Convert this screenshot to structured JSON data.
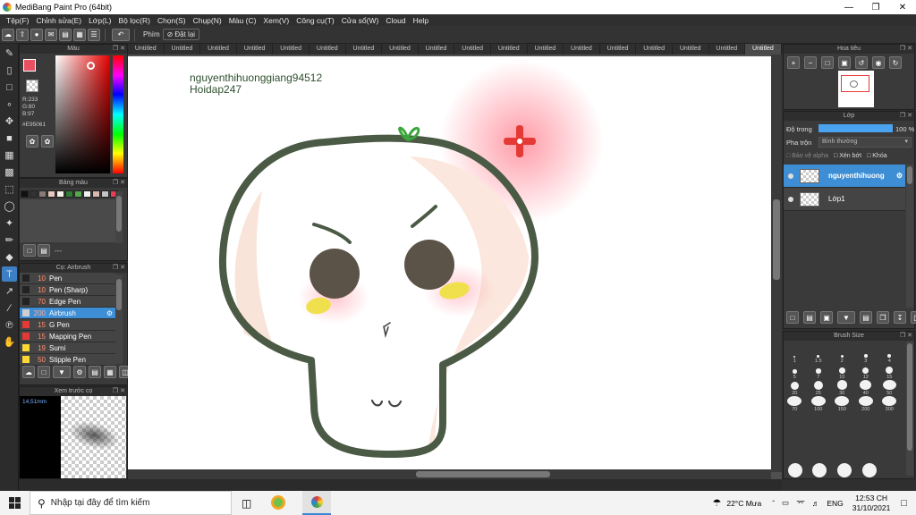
{
  "window": {
    "title": "MediBang Paint Pro (64bit)",
    "minimize_icon": "minimize-icon",
    "maximize_icon": "maximize-icon",
    "close_icon": "close-icon"
  },
  "menu": [
    "Tệp(F)",
    "Chỉnh sửa(E)",
    "Lớp(L)",
    "Bộ lọc(R)",
    "Chọn(S)",
    "Chụp(N)",
    "Màu (C)",
    "Xem(V)",
    "Công cụ(T)",
    "Cửa sổ(W)",
    "Cloud",
    "Help"
  ],
  "toolbar": {
    "shortcut_label": "Phím",
    "reset_label": "Đặt lại"
  },
  "color_panel": {
    "title": "Màu",
    "r": "R:233",
    "g": "G:80",
    "b": "B:97",
    "hex": "#E95061",
    "fg_color": "#e95061"
  },
  "palette_panel": {
    "title": "Bảng màu",
    "swatches": [
      "#111111",
      "#333333",
      "#8a7a75",
      "#e6c9c0",
      "#f7f0e8",
      "#2e7d32",
      "#56a84d",
      "#f1f1f1",
      "#d9b8b0",
      "#c4c4c4",
      "#e53f54"
    ],
    "more": "---"
  },
  "brush_panel": {
    "title": "Cọ: Airbrush",
    "items": [
      {
        "size": "10",
        "name": "Pen",
        "color": "#222222"
      },
      {
        "size": "10",
        "name": "Pen (Sharp)",
        "color": "#222222"
      },
      {
        "size": "70",
        "name": "Edge Pen",
        "color": "#222222"
      },
      {
        "size": "200",
        "name": "Airbrush",
        "color": "#cfcfcf",
        "selected": true
      },
      {
        "size": "15",
        "name": "G Pen",
        "color": "#e53935"
      },
      {
        "size": "15",
        "name": "Mapping Pen",
        "color": "#e53935"
      },
      {
        "size": "19",
        "name": "Sumi",
        "color": "#fdd835"
      },
      {
        "size": "50",
        "name": "Stipple Pen",
        "color": "#fdd835"
      }
    ]
  },
  "preview_panel": {
    "title": "Xem trước cọ",
    "size": "14,51mm"
  },
  "tabs": [
    "Untitled",
    "Untitled",
    "Untitled",
    "Untitled",
    "Untitled",
    "Untitled",
    "Untitled",
    "Untitled",
    "Untitled",
    "Untitled",
    "Untitled",
    "Untitled",
    "Untitled",
    "Untitled",
    "Untitled",
    "Untitled",
    "Untitled",
    "Untitled"
  ],
  "canvas": {
    "line1": "nguyenthihuonggiang94512",
    "line2": "Hoidap247"
  },
  "navigator": {
    "title": "Hoa tiêu"
  },
  "layer_panel": {
    "title": "Lớp",
    "opacity_label": "Độ trong",
    "opacity_value": "100 %",
    "opacity_fraction": 1.0,
    "blend_label": "Pha trộn",
    "blend_value": "Bình thường",
    "protect_alpha": "Bảo vệ alpha",
    "clipping": "Xén bớt",
    "lock": "Khóa",
    "layers": [
      {
        "name": "nguyenthihuong",
        "selected": true
      },
      {
        "name": "Lớp1",
        "selected": false
      }
    ]
  },
  "brush_size_panel": {
    "title": "Brush Size",
    "sizes": [
      "1",
      "1.5",
      "2",
      "3",
      "4",
      "5",
      "7",
      "10",
      "12",
      "15",
      "20",
      "25",
      "30",
      "40",
      "50",
      "70",
      "100",
      "150",
      "200",
      "300"
    ]
  },
  "taskbar": {
    "search_placeholder": "Nhập tại đây để tìm kiếm",
    "weather": "22°C  Mưa",
    "lang": "ENG",
    "time": "12:53 CH",
    "date": "31/10/2021"
  }
}
